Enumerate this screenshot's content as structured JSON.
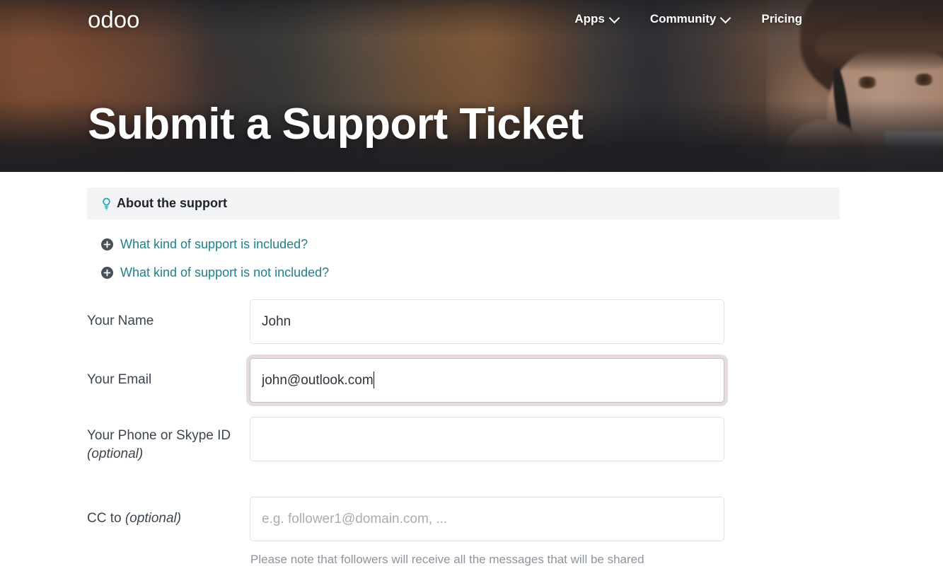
{
  "nav": {
    "brand": "odoo",
    "links": [
      {
        "label": "Apps",
        "has_dropdown": true
      },
      {
        "label": "Community",
        "has_dropdown": true
      },
      {
        "label": "Pricing",
        "has_dropdown": false
      }
    ]
  },
  "hero": {
    "title": "Submit a Support Ticket"
  },
  "info_panel": {
    "header_title": "About the support",
    "header_icon": "lightbulb-icon",
    "faq_items": [
      {
        "label": "What kind of support is included?",
        "icon": "plus-circle-icon"
      },
      {
        "label": "What kind of support is not included?",
        "icon": "plus-circle-icon"
      }
    ]
  },
  "form": {
    "fields": [
      {
        "label": "Your Name",
        "optional_inline": "",
        "optional_block": "",
        "value": "John",
        "placeholder": "",
        "focused": false,
        "help": ""
      },
      {
        "label": "Your Email",
        "optional_inline": "",
        "optional_block": "",
        "value": "john@outlook.com",
        "placeholder": "",
        "focused": true,
        "help": ""
      },
      {
        "label": "Your Phone or Skype ID",
        "optional_inline": "",
        "optional_block": "(optional)",
        "value": "",
        "placeholder": "",
        "focused": false,
        "help": ""
      },
      {
        "label": "CC to",
        "optional_inline": "(optional)",
        "optional_block": "",
        "value": "",
        "placeholder": "e.g. follower1@domain.com, ...",
        "focused": false,
        "help": "Please note that followers will receive all the messages that will be shared"
      }
    ]
  },
  "colors": {
    "link_teal": "#21808d",
    "label_slate": "#3d4550",
    "panel_gray": "#f2f3f4",
    "focus_ring": "#c6b2be",
    "help_gray": "#8d949d"
  }
}
